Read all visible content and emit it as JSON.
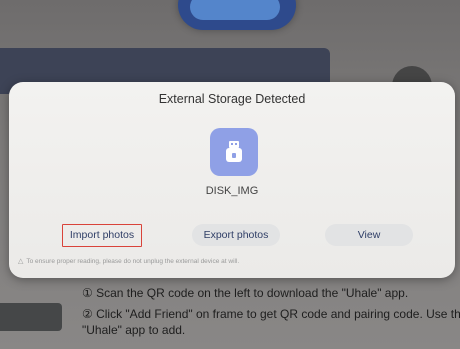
{
  "dialog": {
    "title": "External Storage Detected",
    "drive_name": "DISK_IMG",
    "drive_icon": "usb-drive-icon",
    "buttons": {
      "import": "Import photos",
      "export": "Export photos",
      "view": "View"
    },
    "notice": "To ensure proper reading, please do not unplug the external device at will.",
    "notice_icon": "warning-icon"
  },
  "background": {
    "step1": "① Scan the QR code on the left to download the \"Uhale\" app.",
    "step2": "② Click \"Add Friend\" on frame to get QR code and pairing code. Use the",
    "step2_cont": "\"Uhale\" app to add."
  },
  "colors": {
    "highlight_border": "#d9433a",
    "icon_bg": "#8fa0e6",
    "button_text": "#2f3e66"
  }
}
